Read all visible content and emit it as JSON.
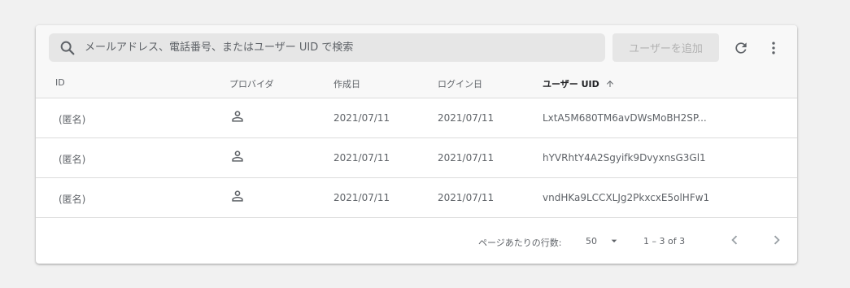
{
  "search": {
    "placeholder": "メールアドレス、電話番号、またはユーザー UID で検索"
  },
  "toolbar": {
    "add_user_label": "ユーザーを追加"
  },
  "table": {
    "headers": {
      "id": "ID",
      "provider": "プロバイダ",
      "created": "作成日",
      "login": "ログイン日",
      "uid": "ユーザー UID"
    },
    "rows": [
      {
        "id": "(匿名)",
        "provider_icon": "person-icon",
        "created": "2021/07/11",
        "login": "2021/07/11",
        "uid": "LxtA5M680TM6avDWsMoBH2SP..."
      },
      {
        "id": "(匿名)",
        "provider_icon": "person-icon",
        "created": "2021/07/11",
        "login": "2021/07/11",
        "uid": "hYVRhtY4A2Sgyifk9DvyxnsG3Gl1"
      },
      {
        "id": "(匿名)",
        "provider_icon": "person-icon",
        "created": "2021/07/11",
        "login": "2021/07/11",
        "uid": "vndHKa9LCCXLJg2PkxcxE5olHFw1"
      }
    ]
  },
  "pagination": {
    "rows_per_page_label": "ページあたりの行数:",
    "rows_per_page_value": "50",
    "range": "1 – 3 of 3"
  },
  "colors": {
    "background": "#f1f1f1",
    "card": "#ffffff",
    "text": "#5f6368",
    "disabled_text": "#b1b1b1"
  }
}
